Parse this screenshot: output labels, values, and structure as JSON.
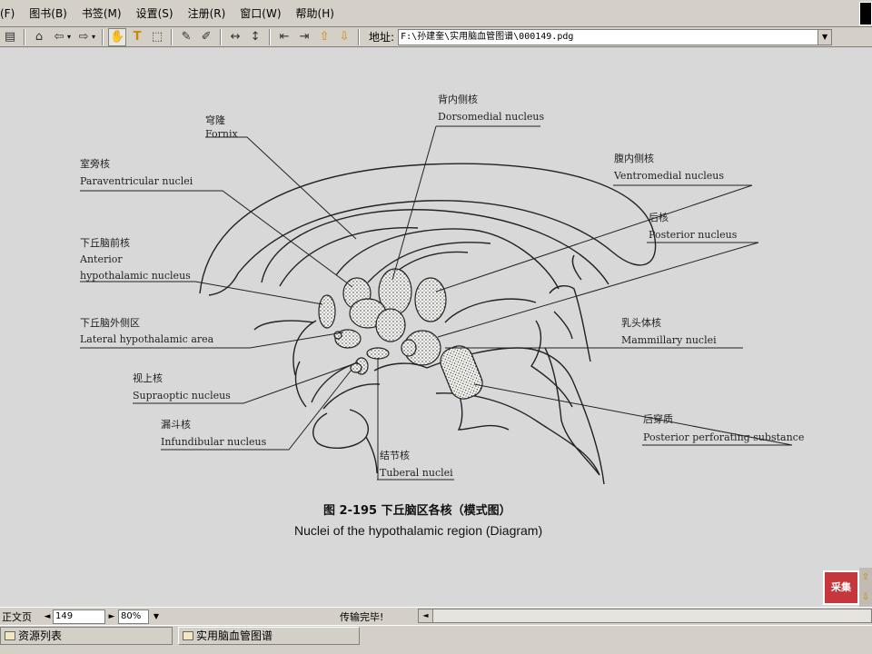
{
  "menubar": {
    "items": [
      {
        "label": "(F)"
      },
      {
        "label": "图书(B)"
      },
      {
        "label": "书签(M)"
      },
      {
        "label": "设置(S)"
      },
      {
        "label": "注册(R)"
      },
      {
        "label": "窗口(W)"
      },
      {
        "label": "帮助(H)"
      }
    ]
  },
  "toolbar": {
    "address_label": "地址:",
    "address_value": "F:\\孙建奎\\实用脑血管图谱\\000149.pdg"
  },
  "figure": {
    "labels": {
      "fornix_cn": "穹隆",
      "fornix_en": "Fornix",
      "dorsomedial_cn": "背内侧核",
      "dorsomedial_en": "Dorsomedial nucleus",
      "paraventricular_cn": "室旁核",
      "paraventricular_en": "Paraventricular nuclei",
      "ventromedial_cn": "腹内侧核",
      "ventromedial_en": "Ventromedial nucleus",
      "anterior_cn": "下丘脑前核",
      "anterior_en_1": "Anterior",
      "anterior_en_2": "hypothalamic nucleus",
      "posterior_cn": "后核",
      "posterior_en": "Posterior nucleus",
      "lateral_cn": "下丘脑外侧区",
      "lateral_en": "Lateral hypothalamic area",
      "mammillary_cn": "乳头体核",
      "mammillary_en": "Mammillary nuclei",
      "supraoptic_cn": "视上核",
      "supraoptic_en": "Supraoptic nucleus",
      "infundibular_cn": "漏斗核",
      "infundibular_en": "Infundibular nucleus",
      "posterior_perf_cn": "后穿质",
      "posterior_perf_en": "Posterior perforating substance",
      "tuberal_cn": "结节核",
      "tuberal_en": "Tuberal nuclei"
    },
    "caption_cn": "图 2-195   下丘脑区各核（模式图）",
    "caption_en": "Nuclei of the hypothalamic region (Diagram)"
  },
  "stamp_text": "采集",
  "statusbar": {
    "view_label": "正文页",
    "page_value": "149",
    "zoom_value": "80%",
    "message": "传输完毕!"
  },
  "taskbar": {
    "resources_label": "资源列表",
    "book_label": "实用脑血管图谱"
  },
  "colors": {
    "chrome": "#d4d0c8",
    "page_background": "#d8d8d8",
    "stamp": "#c6373d"
  }
}
